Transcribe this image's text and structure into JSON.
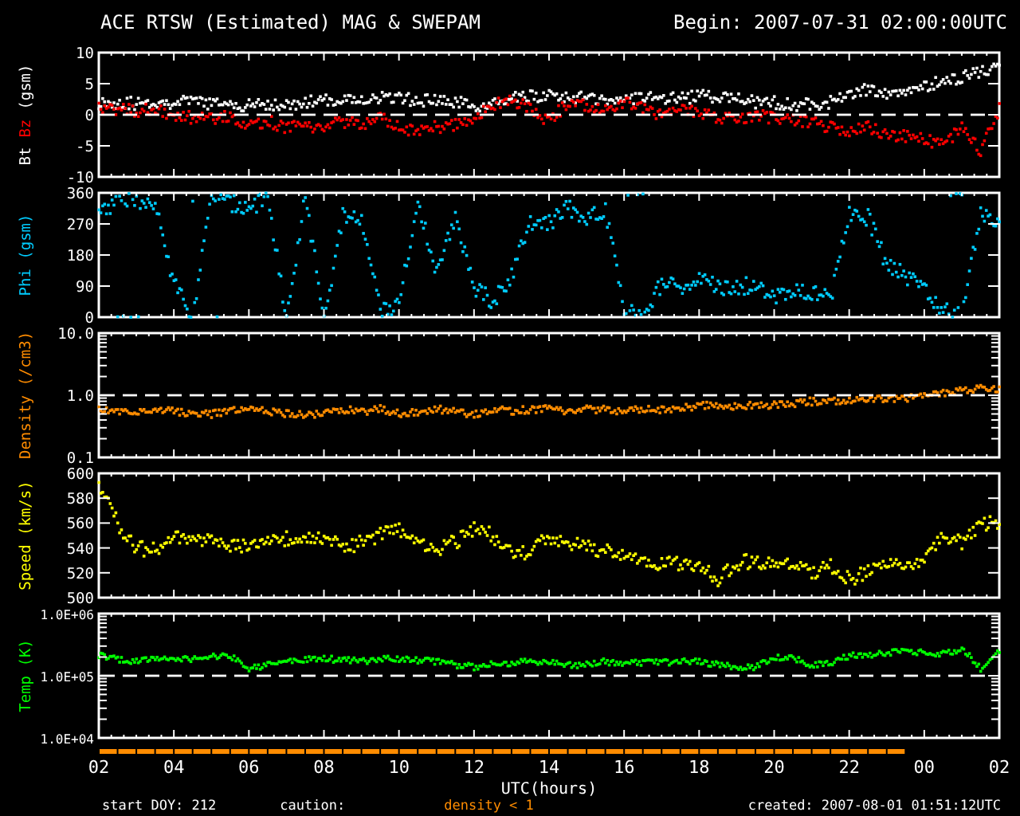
{
  "header": {
    "title": "ACE RTSW (Estimated) MAG & SWEPAM",
    "begin": "Begin: 2007-07-31 02:00:00UTC"
  },
  "panels": [
    {
      "kind": "linear",
      "reference_line": true,
      "title": [
        {
          "text": "Bt",
          "color": "#ffffff"
        },
        {
          "text": "Bz",
          "color": "#ff0000"
        },
        {
          "text": "(gsm)",
          "color": "#ffffff"
        }
      ],
      "ticks": [
        "10",
        "5",
        "0",
        "-5",
        "-10"
      ]
    },
    {
      "kind": "linear",
      "reference_line": false,
      "title": [
        {
          "text": "Phi (gsm)",
          "color": "#00ccff"
        }
      ],
      "ticks": [
        "360",
        "270",
        "180",
        "90",
        "0"
      ]
    },
    {
      "kind": "log",
      "reference_line": true,
      "title": [
        {
          "text": "Density (/cm3)",
          "color": "#ff8c00"
        }
      ],
      "ticks": [
        "10.0",
        "1.0",
        "0.1"
      ]
    },
    {
      "kind": "linear",
      "reference_line": false,
      "title": [
        {
          "text": "Speed (km/s)",
          "color": "#ffff00"
        }
      ],
      "ticks": [
        "600",
        "580",
        "560",
        "540",
        "520",
        "500"
      ]
    },
    {
      "kind": "log",
      "reference_line": true,
      "title": [
        {
          "text": "Temp (K)",
          "color": "#00ff00"
        }
      ],
      "ticks": [
        "1.0E+06",
        "1.0E+05",
        "1.0E+04"
      ]
    }
  ],
  "x_axis": {
    "labels": [
      "02",
      "04",
      "06",
      "08",
      "10",
      "12",
      "14",
      "16",
      "18",
      "20",
      "22",
      "00",
      "02"
    ],
    "title": "UTC(hours)"
  },
  "footer": {
    "start": "start DOY: 212",
    "caution": "caution:",
    "caution_note": "density < 1",
    "created": "created: 2007-08-01 01:51:12UTC"
  }
}
